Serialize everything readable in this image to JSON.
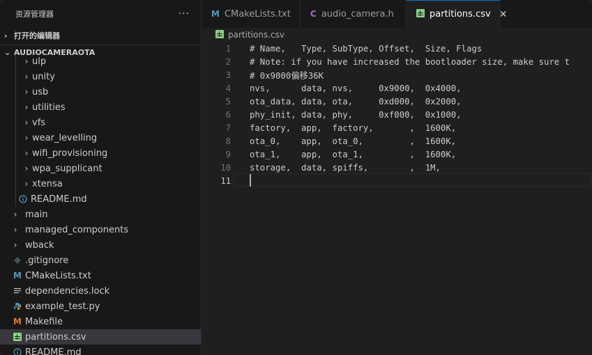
{
  "sidebar": {
    "title": "资源管理器",
    "more": "···",
    "open_editors": "打开的编辑器",
    "project": "AUDIOCAMERAOTA",
    "items": [
      {
        "label": "ulp",
        "type": "folder",
        "icon": "chevron-right-icon"
      },
      {
        "label": "unity",
        "type": "folder",
        "icon": "chevron-right-icon"
      },
      {
        "label": "usb",
        "type": "folder",
        "icon": "chevron-right-icon"
      },
      {
        "label": "utilities",
        "type": "folder",
        "icon": "chevron-right-icon"
      },
      {
        "label": "vfs",
        "type": "folder",
        "icon": "chevron-right-icon"
      },
      {
        "label": "wear_levelling",
        "type": "folder",
        "icon": "chevron-right-icon"
      },
      {
        "label": "wifi_provisioning",
        "type": "folder",
        "icon": "chevron-right-icon"
      },
      {
        "label": "wpa_supplicant",
        "type": "folder",
        "icon": "chevron-right-icon"
      },
      {
        "label": "xtensa",
        "type": "folder",
        "icon": "chevron-right-icon"
      },
      {
        "label": "README.md",
        "type": "file",
        "icon": "info-icon"
      },
      {
        "label": "main",
        "type": "folder",
        "icon": "chevron-right-icon"
      },
      {
        "label": "managed_components",
        "type": "folder",
        "icon": "chevron-right-icon"
      },
      {
        "label": "wback",
        "type": "folder",
        "icon": "chevron-right-icon"
      },
      {
        "label": ".gitignore",
        "type": "file",
        "icon": "git-icon"
      },
      {
        "label": "CMakeLists.txt",
        "type": "file",
        "icon": "cmake-icon"
      },
      {
        "label": "dependencies.lock",
        "type": "file",
        "icon": "lines-icon"
      },
      {
        "label": "example_test.py",
        "type": "file",
        "icon": "python-icon"
      },
      {
        "label": "Makefile",
        "type": "file",
        "icon": "makefile-icon"
      },
      {
        "label": "partitions.csv",
        "type": "file",
        "icon": "csv-icon"
      },
      {
        "label": "README.md",
        "type": "file",
        "icon": "info-icon"
      }
    ]
  },
  "tabs": [
    {
      "label": "CMakeLists.txt",
      "icon": "cmake-icon",
      "glyph": "M"
    },
    {
      "label": "audio_camera.h",
      "icon": "c-header-icon",
      "glyph": "C"
    },
    {
      "label": "partitions.csv",
      "icon": "csv-icon",
      "glyph": "",
      "close": "✕"
    }
  ],
  "breadcrumb": {
    "file": "partitions.csv"
  },
  "editor": {
    "lines": [
      {
        "n": "1",
        "text": "# Name,   Type, SubType, Offset,  Size, Flags"
      },
      {
        "n": "2",
        "text": "# Note: if you have increased the bootloader size, make sure t"
      },
      {
        "n": "3",
        "text": "# 0x9000偏移36K"
      },
      {
        "n": "4",
        "text": "nvs,      data, nvs,     0x9000,  0x4000,"
      },
      {
        "n": "5",
        "text": "ota_data, data, ota,     0xd000,  0x2000,"
      },
      {
        "n": "6",
        "text": "phy_init, data, phy,     0xf000,  0x1000,"
      },
      {
        "n": "7",
        "text": "factory,  app,  factory,       ,  1600K,"
      },
      {
        "n": "8",
        "text": "ota_0,    app,  ota_0,         ,  1600K,"
      },
      {
        "n": "9",
        "text": "ota_1,    app,  ota_1,         ,  1600K,"
      },
      {
        "n": "10",
        "text": "storage,  data, spiffs,        ,  1M,"
      },
      {
        "n": "11",
        "text": ""
      }
    ],
    "current_line": "11"
  },
  "colors": {
    "accent": "#0078d4",
    "csv": "#89d185",
    "cmake": "#519aba",
    "c_header": "#a074c4",
    "makefile": "#e37933",
    "python": "#4b8bbe",
    "info": "#519aba"
  }
}
